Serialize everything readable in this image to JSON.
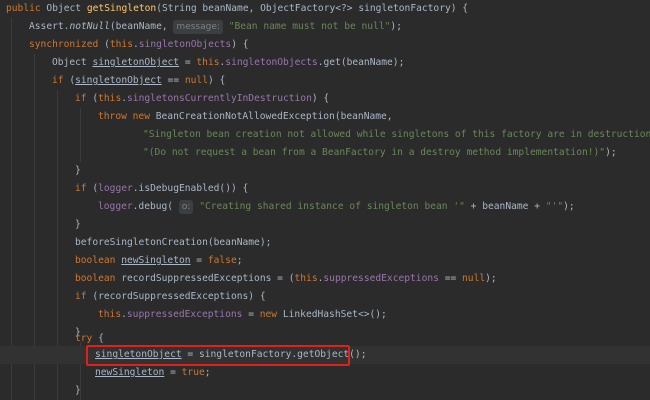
{
  "code": {
    "l0": {
      "kw": "public",
      "type": " Object ",
      "fn": "getSingleton",
      "rest": "(String beanName, ObjectFactory<?> singletonFactory) {"
    },
    "l1": {
      "a": "Assert.",
      "call": "notNull",
      "b": "(beanName, ",
      "hint": "message:",
      "str": "\"Bean name must not be null\"",
      "c": ");"
    },
    "l2": {
      "kw": "synchronized",
      "a": " (",
      "kw2": "this",
      "b": ".",
      "fld": "singletonObjects",
      "c": ") {"
    },
    "l3": {
      "a": "Object ",
      "var": "singletonObject",
      "b": " = ",
      "kw": "this",
      "c": ".",
      "fld": "singletonObjects",
      "d": ".get(beanName);"
    },
    "l4": {
      "kw": "if",
      "a": " (",
      "var": "singletonObject",
      "b": " == ",
      "kw2": "null",
      "c": ") {"
    },
    "l5": {
      "kw": "if",
      "a": " (",
      "kw2": "this",
      "b": ".",
      "fld": "singletonsCurrentlyInDestruction",
      "c": ") {"
    },
    "l6": {
      "kw": "throw new",
      "a": " BeanCreationNotAllowedException(beanName,"
    },
    "l7": {
      "str": "\"Singleton bean creation not allowed while singletons of this factory are in destruction \"",
      "a": " +"
    },
    "l8": {
      "str": "\"(Do not request a bean from a BeanFactory in a destroy method implementation!)\"",
      "a": ");"
    },
    "l9": {
      "a": "}"
    },
    "l10": {
      "kw": "if",
      "a": " (",
      "fld": "logger",
      "b": ".isDebugEnabled()) {"
    },
    "l11": {
      "fld": "logger",
      "a": ".debug( ",
      "hint": "o:",
      "str": "\"Creating shared instance of singleton bean '\"",
      "b": " + beanName + ",
      "str2": "\"'\"",
      "c": ");"
    },
    "l12": {
      "a": "}"
    },
    "l13": {
      "a": "beforeSingletonCreation(beanName);"
    },
    "l14": {
      "kw": "boolean",
      "a": " ",
      "var": "newSingleton",
      "b": " = ",
      "kw2": "false",
      "c": ";"
    },
    "l15": {
      "kw": "boolean",
      "a": " recordSuppressedExceptions = (",
      "kw2": "this",
      "b": ".",
      "fld": "suppressedExceptions",
      "c": " == ",
      "kw3": "null",
      "d": ");"
    },
    "l16": {
      "kw": "if",
      "a": " (recordSuppressedExceptions) {"
    },
    "l17": {
      "kw": "this",
      "a": ".",
      "fld": "suppressedExceptions",
      "b": " = ",
      "kw2": "new",
      "c": " LinkedHashSet<>();"
    },
    "l18": {
      "a": "}"
    },
    "l19": {
      "kw": "try",
      "a": " {"
    },
    "l20": {
      "var": "singletonObject",
      "a": " = singletonFactory.getObject();"
    },
    "l21": {
      "var": "newSingleton",
      "a": " = ",
      "kw": "true",
      "b": ";"
    },
    "l22": {
      "a": "}"
    }
  },
  "colors": {
    "background": "#2b2b2b",
    "keyword": "#cc7832",
    "method": "#ffc66d",
    "string": "#6a8759",
    "field": "#9876aa",
    "highlight_box": "#e0201a"
  }
}
